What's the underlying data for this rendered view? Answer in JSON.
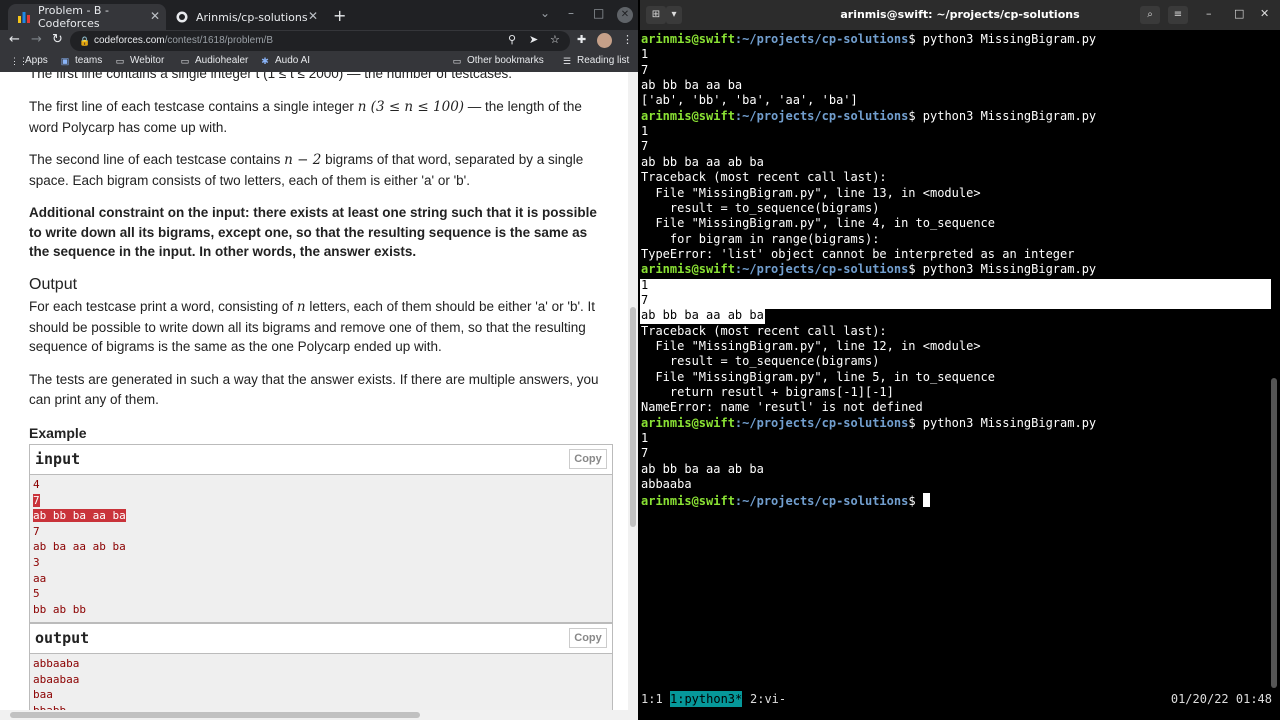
{
  "browser": {
    "tabs": [
      {
        "label": "Problem - B - Codeforces",
        "active": true
      },
      {
        "label": "Arinmis/cp-solutions",
        "active": false
      }
    ],
    "new_tab": "+",
    "url_host": "codeforces.com",
    "url_path": "/contest/1618/problem/B",
    "bookmarks": [
      "Apps",
      "teams",
      "Webitor",
      "Audiohealer",
      "Audo AI"
    ],
    "other_bookmarks": "Other bookmarks",
    "reading_list": "Reading list"
  },
  "problem": {
    "cut_line": "The first line contains a single integer t (1 ≤ t ≤ 2000) — the number of testcases.",
    "p1_a": "The first line of each testcase contains a single integer ",
    "p1_math": "n (3 ≤ n ≤ 100)",
    "p1_b": " — the length of the word Polycarp has come up with.",
    "p2_a": "The second line of each testcase contains ",
    "p2_math": "n − 2",
    "p2_b": " bigrams of that word, separated by a single space. Each bigram consists of two letters, each of them is either 'a' or 'b'.",
    "p3": "Additional constraint on the input: there exists at least one string such that it is possible to write down all its bigrams, except one, so that the resulting sequence is the same as the sequence in the input. In other words, the answer exists.",
    "output_heading": "Output",
    "p4_a": "For each testcase print a word, consisting of ",
    "p4_math": "n",
    "p4_b": " letters, each of them should be either 'a' or 'b'. It should be possible to write down all its bigrams and remove one of them, so that the resulting sequence of bigrams is the same as the one Polycarp ended up with.",
    "p5": "The tests are generated in such a way that the answer exists. If there are multiple answers, you can print any of them.",
    "example_title": "Example",
    "input_label": "input",
    "output_label": "output",
    "copy_label": "Copy",
    "input_lines": [
      "4",
      "7",
      "ab bb ba aa ba",
      "7",
      "ab ba aa ab ba",
      "3",
      "aa",
      "5",
      "bb ab bb"
    ],
    "output_lines": [
      "abbaaba",
      "abaabaa",
      "baa",
      "bbabb"
    ]
  },
  "terminal": {
    "title": "arinmis@swift: ~/projects/cp-solutions",
    "user": "arinmis@swift",
    "path": ":~/projects/cp-solutions",
    "prompt_end": "$ ",
    "lines": [
      {
        "kind": "prompt",
        "cmd": "python3 MissingBigram.py"
      },
      {
        "kind": "out",
        "text": "1"
      },
      {
        "kind": "out",
        "text": "7"
      },
      {
        "kind": "out",
        "text": "ab bb ba aa ba"
      },
      {
        "kind": "out",
        "text": "['ab', 'bb', 'ba', 'aa', 'ba']"
      },
      {
        "kind": "prompt",
        "cmd": "python3 MissingBigram.py"
      },
      {
        "kind": "out",
        "text": "1"
      },
      {
        "kind": "out",
        "text": "7"
      },
      {
        "kind": "out",
        "text": "ab bb ba aa ab ba"
      },
      {
        "kind": "out",
        "text": "Traceback (most recent call last):"
      },
      {
        "kind": "out",
        "text": "  File \"MissingBigram.py\", line 13, in <module>"
      },
      {
        "kind": "out",
        "text": "    result = to_sequence(bigrams)"
      },
      {
        "kind": "out",
        "text": "  File \"MissingBigram.py\", line 4, in to_sequence"
      },
      {
        "kind": "out",
        "text": "    for bigram in range(bigrams):"
      },
      {
        "kind": "out",
        "text": "TypeError: 'list' object cannot be interpreted as an integer"
      },
      {
        "kind": "prompt",
        "cmd": "python3 MissingBigram.py"
      },
      {
        "kind": "sel",
        "text": "1"
      },
      {
        "kind": "sel",
        "text": "7"
      },
      {
        "kind": "sel",
        "text": "ab bb ba aa ab ba"
      },
      {
        "kind": "out",
        "text": "Traceback (most recent call last):"
      },
      {
        "kind": "out",
        "text": "  File \"MissingBigram.py\", line 12, in <module>"
      },
      {
        "kind": "out",
        "text": "    result = to_sequence(bigrams)"
      },
      {
        "kind": "out",
        "text": "  File \"MissingBigram.py\", line 5, in to_sequence"
      },
      {
        "kind": "out",
        "text": "    return resutl + bigrams[-1][-1]"
      },
      {
        "kind": "out",
        "text": "NameError: name 'resutl' is not defined"
      },
      {
        "kind": "prompt",
        "cmd": "python3 MissingBigram.py"
      },
      {
        "kind": "out",
        "text": "1"
      },
      {
        "kind": "out",
        "text": "7"
      },
      {
        "kind": "out",
        "text": "ab bb ba aa ab ba"
      },
      {
        "kind": "out",
        "text": "abbaaba"
      },
      {
        "kind": "prompt_cursor",
        "cmd": ""
      }
    ],
    "status": {
      "session": "1:1",
      "window1": "1:python3*",
      "window2": "2:vi-",
      "clock": "01/20/22 01:48"
    }
  }
}
